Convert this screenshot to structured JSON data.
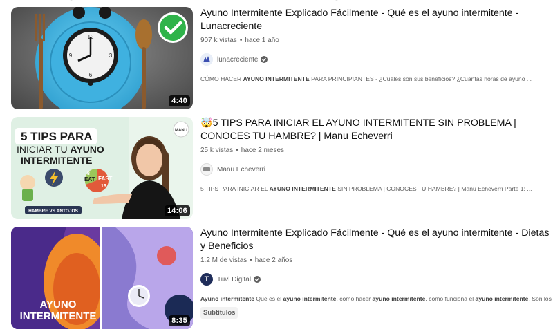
{
  "results": [
    {
      "title": "Ayuno Intermitente Explicado Fácilmente - Qué es el ayuno intermitente - Lunacreciente",
      "views": "907 k vistas",
      "age": "hace 1 año",
      "channel": "lunacreciente",
      "verified": true,
      "desc_pre": "CÓMO HACER ",
      "desc_b1": "AYUNO INTERMITENTE",
      "desc_mid": " PARA PRINCIPIANTES - ¿Cuáles son sus beneficios? ¿Cuántas horas de ayuno ...",
      "duration": "4:40"
    },
    {
      "emoji": "🤯",
      "title": "5 TIPS PARA INICIAR EL AYUNO INTERMITENTE SIN PROBLEMA | CONOCES TU HAMBRE? | Manu Echeverri",
      "views": "25 k vistas",
      "age": "hace 2 meses",
      "channel": "Manu Echeverri",
      "verified": false,
      "desc_pre": "5 TIPS PARA INICIAR EL ",
      "desc_b1": "AYUNO INTERMITENTE",
      "desc_mid": " SIN PROBLEMA | CONOCES TU HAMBRE? | Manu Echeverri Parte 1: ...",
      "duration": "14:06",
      "thumb_text": {
        "line1": "5 TIPS PARA",
        "line2a": "INICIAR TU ",
        "line2b": "AYUNO",
        "line3": "INTERMITENTE",
        "tag": "HAMBRE VS ANTOJOS",
        "eat": "EAT",
        "fast": "FAST",
        "eight": "8",
        "sixteen": "16",
        "logo": "MANU"
      }
    },
    {
      "title": "Ayuno Intermitente Explicado Fácilmente - Qué es el ayuno intermitente - Dietas y Beneficios",
      "views": "1.2 M de vistas",
      "age": "hace 2 años",
      "channel": "Tuvi Digital",
      "channel_initial": "T",
      "verified": true,
      "desc_b1": "Ayuno intermitente",
      "desc_t1": " Qué es el ",
      "desc_b2": "ayuno intermitente",
      "desc_t2": ", cómo hacer ",
      "desc_b3": "ayuno intermitente",
      "desc_t3": ", cómo funciona el ",
      "desc_b4": "ayuno intermitente",
      "desc_t4": ". Son los ...",
      "chip": "Subtítulos",
      "duration": "8:35",
      "thumb_text": {
        "line1": "AYUNO",
        "line2": "INTERMITENTE"
      }
    }
  ],
  "meta_separator": "•",
  "colors": {
    "plate": "#45b8e6",
    "check": "#2fb34a",
    "tuvi_purple": "#5a3ea8",
    "tuvi_orange": "#f08a2a"
  }
}
